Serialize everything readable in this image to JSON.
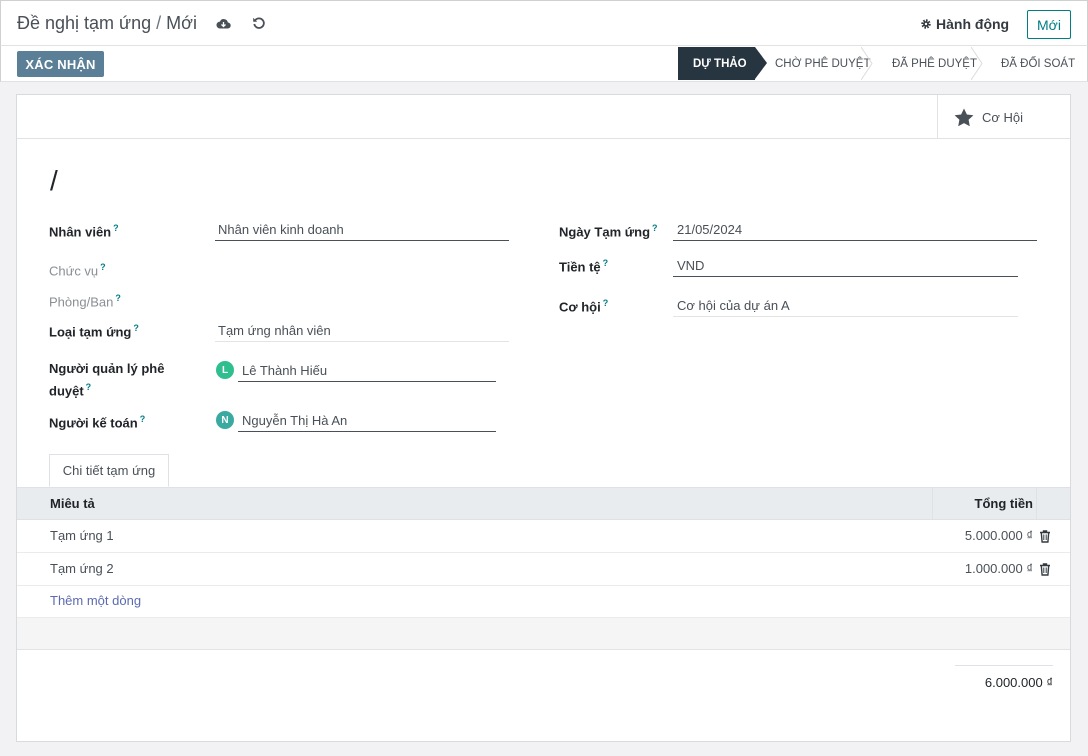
{
  "header": {
    "breadcrumb_parent": "Đề nghị tạm ứng",
    "breadcrumb_sep": "/",
    "breadcrumb_current": "Mới",
    "action_label": "Hành động",
    "new_label": "Mới"
  },
  "statusbar": {
    "confirm_label": "XÁC NHẬN",
    "stages": [
      {
        "label": "DỰ THẢO",
        "active": true
      },
      {
        "label": "CHỜ PHÊ DUYỆT",
        "active": false
      },
      {
        "label": "ĐÃ PHÊ DUYỆT",
        "active": false
      },
      {
        "label": "ĐÃ ĐỐI SOÁT",
        "active": false
      }
    ]
  },
  "smart_button": {
    "label": "Cơ Hội",
    "icon": "star-icon"
  },
  "record": {
    "title": "/",
    "help_mark": "?",
    "left": {
      "employee": {
        "label": "Nhân viên",
        "value": "Nhân viên kinh doanh"
      },
      "job_position": {
        "label": "Chức vụ",
        "value": ""
      },
      "department": {
        "label": "Phòng/Ban",
        "value": ""
      },
      "advance_type": {
        "label": "Loại tạm ứng",
        "value": "Tạm ứng nhân viên"
      },
      "approver": {
        "label_line1": "Người quản lý phê",
        "label_line2": "duyệt",
        "value": "Lê Thành Hiếu",
        "avatar_letter": "L",
        "avatar_color": "#2fbe8f"
      },
      "accountant": {
        "label": "Người kế toán",
        "value": "Nguyễn Thị Hà An",
        "avatar_letter": "N",
        "avatar_color": "#3aa99f"
      }
    },
    "right": {
      "advance_date": {
        "label": "Ngày Tạm ứng",
        "value": "21/05/2024"
      },
      "currency": {
        "label": "Tiền tệ",
        "value": "VND"
      },
      "opportunity": {
        "label": "Cơ hội",
        "value": "Cơ hội của dự án A"
      }
    }
  },
  "tabs": [
    {
      "label": "Chi tiết tạm ứng"
    }
  ],
  "lines": {
    "headers": {
      "description": "Miêu tả",
      "total": "Tổng tiền"
    },
    "rows": [
      {
        "description": "Tạm ứng 1",
        "amount": "5.000.000 ₫"
      },
      {
        "description": "Tạm ứng 2",
        "amount": "1.000.000 ₫"
      }
    ],
    "add_line_label": "Thêm một dòng",
    "grand_total": "6.000.000 ₫"
  },
  "colors": {
    "accent": "#017e84",
    "confirm": "#5b7f96",
    "active_stage": "#263540"
  }
}
